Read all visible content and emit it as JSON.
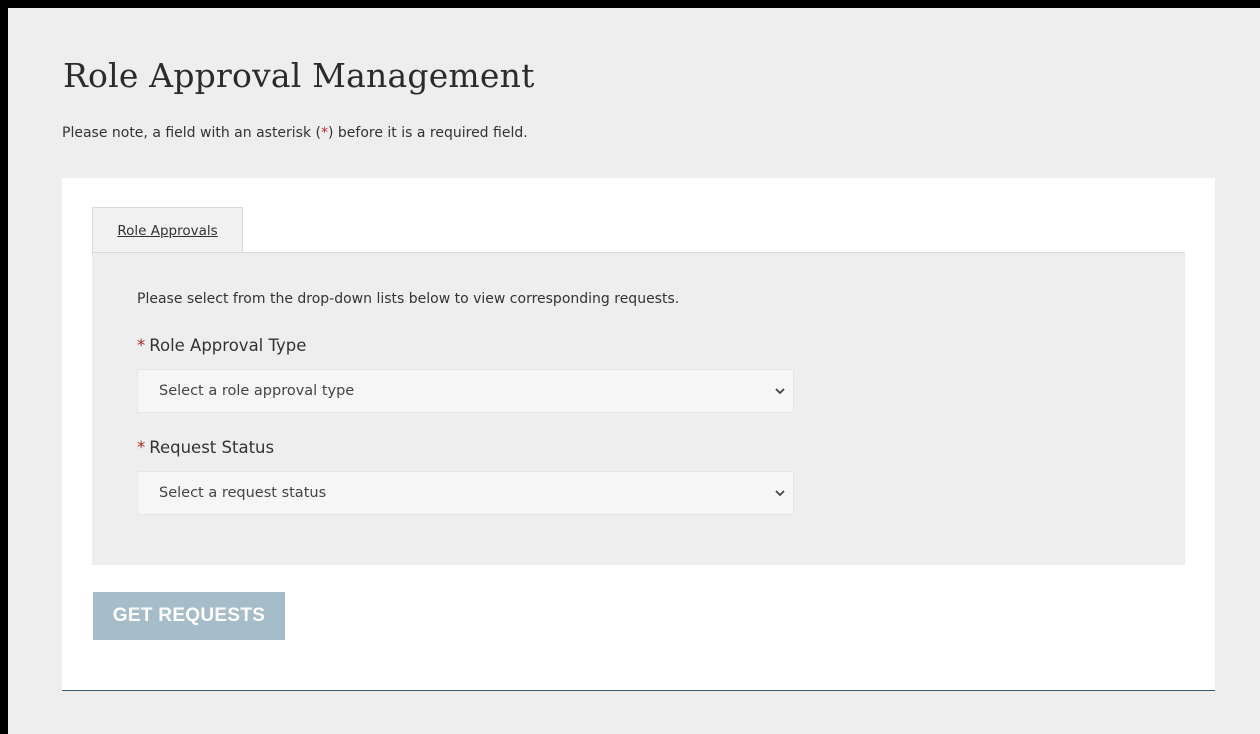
{
  "page": {
    "title": "Role Approval Management",
    "note_prefix": "Please note, a field with an asterisk (",
    "note_asterisk": "*",
    "note_suffix": ") before it is a required field."
  },
  "tabs": [
    {
      "label": "Role Approvals",
      "active": true
    }
  ],
  "panel": {
    "instructions": "Please select from the drop-down lists below to view corresponding requests.",
    "fields": [
      {
        "required_mark": "*",
        "label": "Role Approval Type",
        "placeholder": "Select a role approval type"
      },
      {
        "required_mark": "*",
        "label": "Request Status",
        "placeholder": "Select a request status"
      }
    ]
  },
  "actions": {
    "get_requests_label": "GET REQUESTS",
    "get_requests_disabled": true
  },
  "colors": {
    "required_asterisk": "#b02a2a",
    "button_disabled": "#a6bcc9",
    "card_bottom_border": "#3d5a73"
  }
}
